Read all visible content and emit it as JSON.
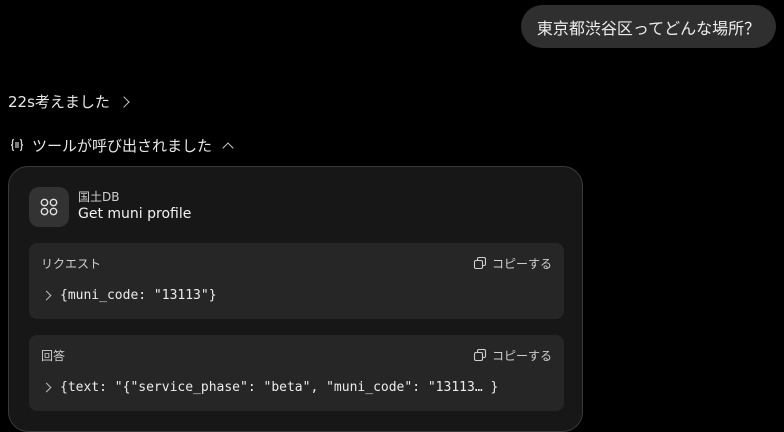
{
  "user_message": "東京都渋谷区ってどんな場所？",
  "thought": {
    "label": "22s考えました"
  },
  "tool_call": {
    "label": "ツールが呼び出されました",
    "server_name": "国土DB",
    "tool_name": "Get muni profile",
    "request": {
      "label": "リクエスト",
      "copy_label": "コピーする",
      "code": "{muni_code: \"13113\"}"
    },
    "response": {
      "label": "回答",
      "copy_label": "コピーする",
      "code": "{text: \"{\"service_phase\": \"beta\", \"muni_code\": \"13113… }"
    }
  },
  "icons": {
    "thought_chevron": "chevron-right-icon",
    "tool_indicator": "tool-braces-icon",
    "tool_collapse": "chevron-up-icon",
    "server": "connector-icon",
    "copy": "copy-icon"
  }
}
